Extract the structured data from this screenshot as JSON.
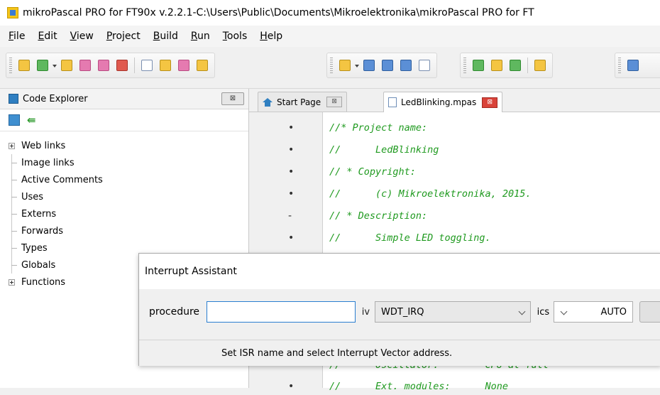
{
  "window": {
    "title": "mikroPascal PRO for FT90x v.2.2.1-C:\\Users\\Public\\Documents\\Mikroelektronika\\mikroPascal PRO for FT"
  },
  "menu": {
    "items": [
      {
        "accel": "F",
        "rest": "ile"
      },
      {
        "accel": "E",
        "rest": "dit"
      },
      {
        "accel": "V",
        "rest": "iew"
      },
      {
        "accel": "P",
        "rest": "roject"
      },
      {
        "accel": "B",
        "rest": "uild"
      },
      {
        "accel": "R",
        "rest": "un"
      },
      {
        "accel": "T",
        "rest": "ools"
      },
      {
        "accel": "H",
        "rest": "elp"
      }
    ]
  },
  "explorer": {
    "title": "Code Explorer",
    "close_label": "⊠",
    "tool2": "⇚",
    "tree": [
      {
        "label": "Web links",
        "expandable": true
      },
      {
        "label": "Image links",
        "expandable": false
      },
      {
        "label": "Active Comments",
        "expandable": false
      },
      {
        "label": "Uses",
        "expandable": false
      },
      {
        "label": "Externs",
        "expandable": false
      },
      {
        "label": "Forwards",
        "expandable": false
      },
      {
        "label": "Types",
        "expandable": false
      },
      {
        "label": "Globals",
        "expandable": false
      },
      {
        "label": "Functions",
        "expandable": true
      }
    ]
  },
  "tabs": [
    {
      "label": "Start Page",
      "close": "⊠"
    },
    {
      "label": "LedBlinking.mpas",
      "close": "⊠"
    }
  ],
  "editor": {
    "lines": [
      {
        "marker": "•",
        "text": "//* Project name:"
      },
      {
        "marker": "•",
        "text": "//      LedBlinking"
      },
      {
        "marker": "•",
        "text": "// * Copyright:"
      },
      {
        "marker": "•",
        "text": "//      (c) Mikroelektronika, 2015."
      },
      {
        "marker": "-",
        "text": "// * Description:"
      },
      {
        "marker": "•",
        "text": "//      Simple LED toggling."
      },
      {
        "marker": "•",
        "text": "//      Oscillator:        CPU at full"
      },
      {
        "marker": "•",
        "text": "//      Ext. modules:      None"
      }
    ]
  },
  "dialog": {
    "title": "Interrupt Assistant",
    "procedure_label": "procedure",
    "procedure_value": "",
    "iv_label": "iv",
    "iv_value": "WDT_IRQ",
    "ics_label": "ics",
    "ics_value": "AUTO",
    "status": "Set ISR name and select Interrupt Vector address."
  }
}
